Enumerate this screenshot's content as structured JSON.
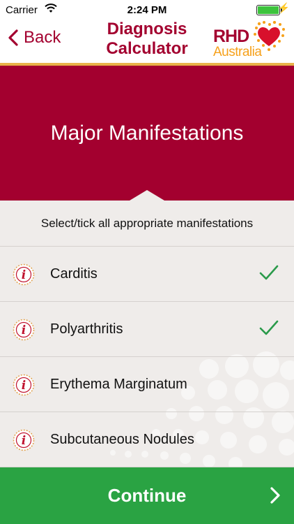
{
  "status_bar": {
    "carrier": "Carrier",
    "time": "2:24 PM",
    "battery_level": 1.0
  },
  "nav": {
    "back_label": "Back",
    "title_line1": "Diagnosis",
    "title_line2": "Calculator",
    "logo_rhd": "RHD",
    "logo_australia": "Australia"
  },
  "header": {
    "title": "Major Manifestations"
  },
  "instructions": "Select/tick all appropriate manifestations",
  "manifestations": [
    {
      "label": "Carditis",
      "checked": true
    },
    {
      "label": "Polyarthritis",
      "checked": true
    },
    {
      "label": "Erythema Marginatum",
      "checked": false
    },
    {
      "label": "Subcutaneous Nodules",
      "checked": false
    }
  ],
  "continue_label": "Continue",
  "colors": {
    "brand": "#a3002f",
    "accent_gold": "#e8b24a",
    "continue_green": "#2aa343",
    "check_green": "#2a9a4a",
    "logo_orange": "#f6a11b"
  },
  "icons": {
    "back": "chevron-left-icon",
    "info": "info-icon",
    "check": "checkmark-icon",
    "continue": "chevron-right-icon"
  }
}
